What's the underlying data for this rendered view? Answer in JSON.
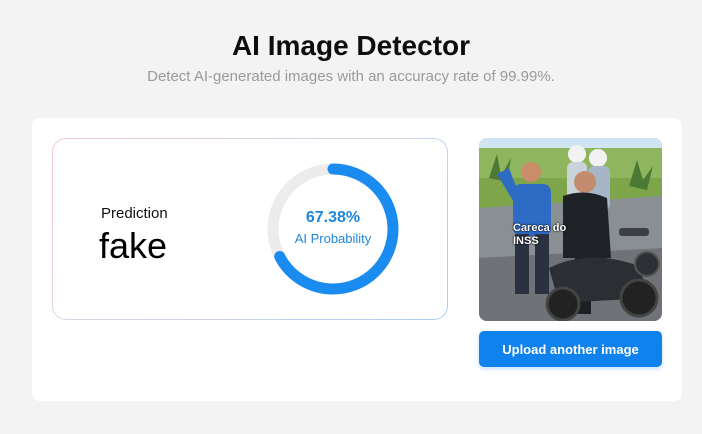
{
  "header": {
    "title": "AI Image Detector",
    "subtitle": "Detect AI-generated images with an accuracy rate of 99.99%."
  },
  "result": {
    "prediction_label": "Prediction",
    "prediction_value": "fake",
    "probability_text": "67.38%",
    "probability_fraction": 0.6738,
    "probability_label": "AI Probability",
    "gauge_color": "#1a8cf0",
    "gauge_track_color": "#ececec"
  },
  "image": {
    "caption": "Careca do INSS"
  },
  "actions": {
    "upload_label": "Upload another image"
  },
  "colors": {
    "accent": "#0f82ee",
    "title": "#0d0d0d",
    "subtitle": "#9a9a9a"
  }
}
